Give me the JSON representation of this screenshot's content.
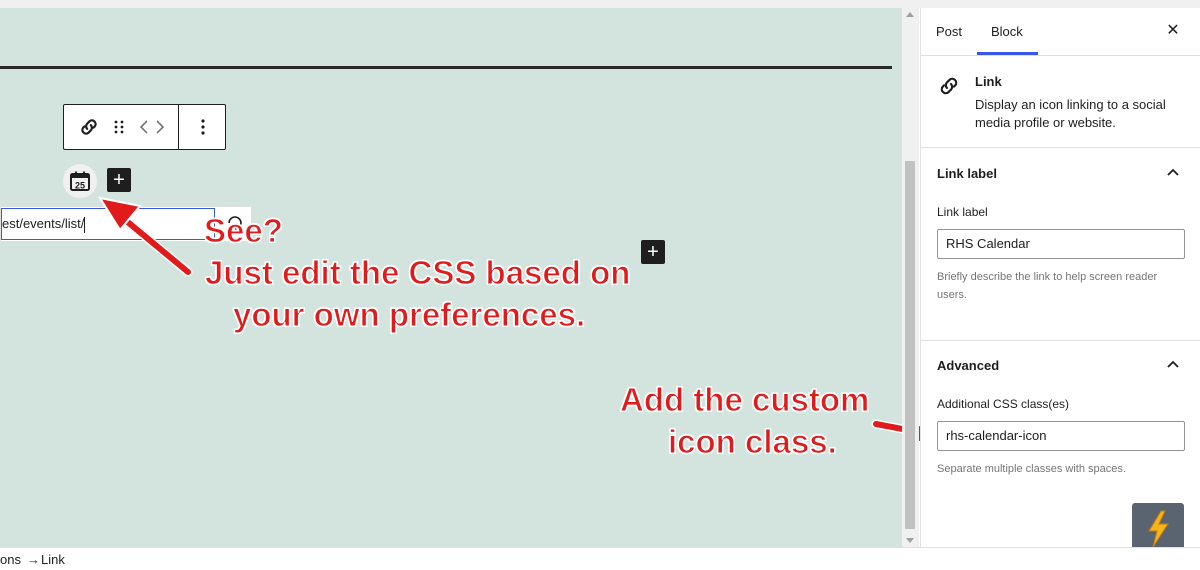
{
  "editor": {
    "url_value": "est/events/list/",
    "social_icon": "calendar-icon",
    "calendar_day": "25",
    "add_symbol": "+"
  },
  "annotations": {
    "see": "See?",
    "edit_line1": "Just edit the CSS based on",
    "edit_line2": "your own preferences.",
    "add_line1": "Add the custom",
    "add_line2": "icon class.",
    "color": "#e11b1b"
  },
  "sidebar": {
    "tabs": [
      {
        "label": "Post"
      },
      {
        "label": "Block"
      }
    ],
    "close_symbol": "✕",
    "block_card": {
      "title": "Link",
      "description": "Display an icon linking to a social media profile or website."
    },
    "link_label_panel": {
      "title": "Link label",
      "field_label": "Link label",
      "field_value": "RHS Calendar",
      "help": "Briefly describe the link to help screen reader users."
    },
    "advanced_panel": {
      "title": "Advanced",
      "field_label": "Additional CSS class(es)",
      "field_value": "rhs-calendar-icon",
      "help": "Separate multiple classes with spaces."
    }
  },
  "footer": {
    "breadcrumbs": [
      {
        "label": "ons"
      },
      {
        "label": "→"
      },
      {
        "label": "Link"
      }
    ]
  },
  "colors": {
    "canvas_bg": "#d3e4df",
    "accent": "#3858e9",
    "arrow": "#e11b1b"
  }
}
